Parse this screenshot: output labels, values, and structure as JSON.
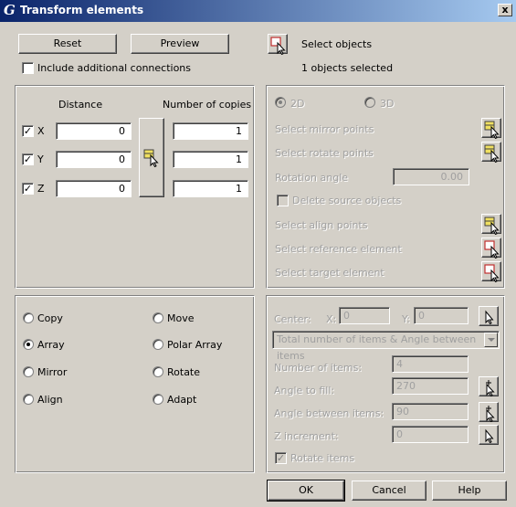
{
  "window": {
    "title": "Transform elements",
    "app_glyph": "G",
    "close_glyph": "x"
  },
  "toolbar": {
    "reset_label": "Reset",
    "preview_label": "Preview",
    "select_objects_label": "Select objects",
    "selected_count_text": "1 objects selected"
  },
  "include_connections": {
    "label": "Include additional connections",
    "checked": false
  },
  "distance_panel": {
    "distance_header": "Distance",
    "copies_header": "Number of copies",
    "rows": [
      {
        "axis": "X",
        "checked": true,
        "distance": "0",
        "copies": "1"
      },
      {
        "axis": "Y",
        "checked": true,
        "distance": "0",
        "copies": "1"
      },
      {
        "axis": "Z",
        "checked": true,
        "distance": "0",
        "copies": "1"
      }
    ]
  },
  "mode_panel": {
    "mode_2d": "2D",
    "mode_3d": "3D",
    "selected": "2D",
    "select_mirror_points": "Select mirror points",
    "select_rotate_points": "Select rotate points",
    "rotation_angle_label": "Rotation angle",
    "rotation_angle_value": "0.00",
    "delete_source_label": "Delete source objects",
    "select_align_points": "Select align points",
    "select_reference_element": "Select reference element",
    "select_target_element": "Select target element"
  },
  "operation_panel": {
    "options": [
      "Copy",
      "Move",
      "Array",
      "Polar Array",
      "Mirror",
      "Rotate",
      "Align",
      "Adapt"
    ],
    "selected": "Array"
  },
  "polar_panel": {
    "center_label": "Center:",
    "x_label": "X:",
    "x_value": "0",
    "y_label": "Y:",
    "y_value": "0",
    "mode_select": "Total number of items & Angle between items",
    "number_of_items_label": "Number of items:",
    "number_of_items_value": "4",
    "angle_to_fill_label": "Angle to fill:",
    "angle_to_fill_value": "270",
    "angle_between_label": "Angle between items:",
    "angle_between_value": "90",
    "z_increment_label": "Z increment:",
    "z_increment_value": "0",
    "rotate_items_label": "Rotate items",
    "rotate_items_checked": true
  },
  "footer": {
    "ok_label": "OK",
    "cancel_label": "Cancel",
    "help_label": "Help"
  }
}
